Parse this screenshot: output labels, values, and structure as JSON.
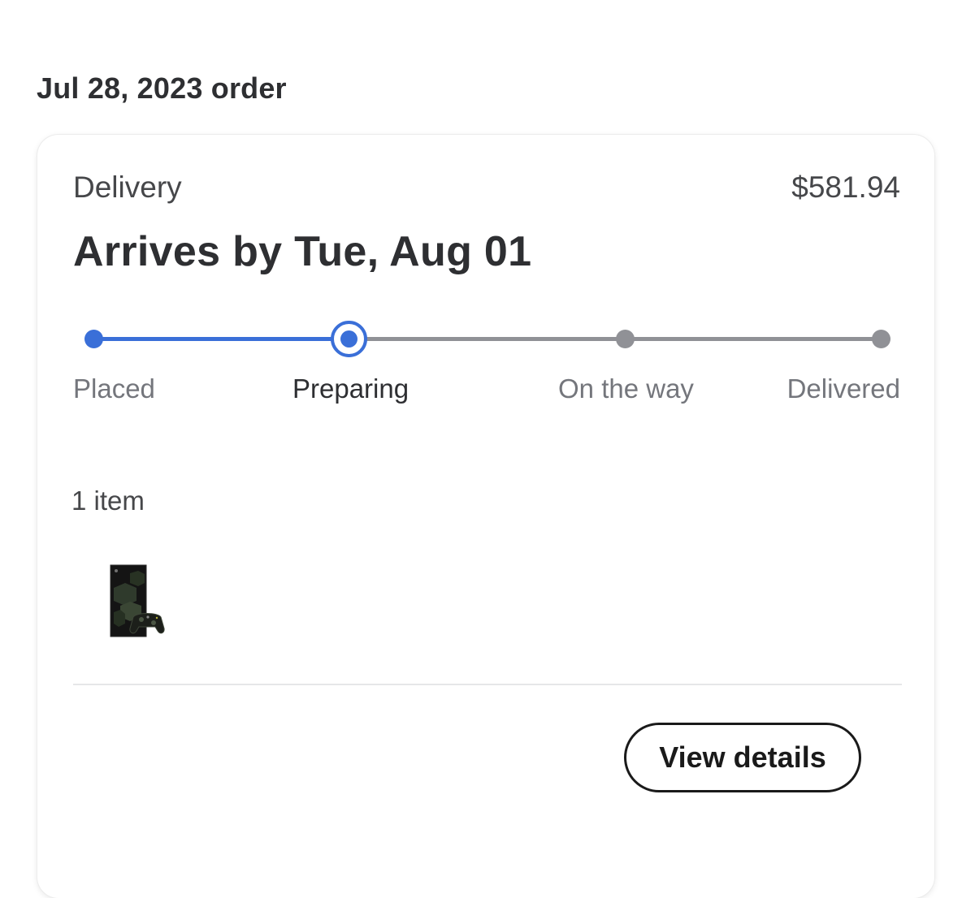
{
  "order": {
    "date_heading": "Jul 28, 2023 order"
  },
  "card": {
    "fulfillment_type": "Delivery",
    "total": "$581.94",
    "arrival": "Arrives by Tue, Aug 01",
    "progress": {
      "steps": [
        "Placed",
        "Preparing",
        "On the way",
        "Delivered"
      ],
      "current_step_index": 1
    },
    "item_count": "1 item",
    "items": [
      {
        "icon": "game-console-product-image"
      }
    ],
    "view_details_label": "View details"
  },
  "colors": {
    "accent": "#3a6fd8",
    "inactive": "#909196",
    "text_primary": "#2e2f32"
  }
}
